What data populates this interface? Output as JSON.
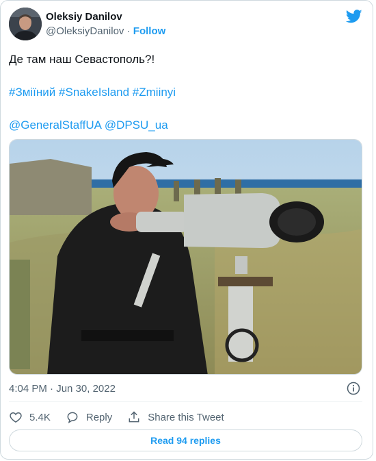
{
  "author": {
    "name": "Oleksiy Danilov",
    "handle": "@OleksiyDanilov",
    "separator": "·",
    "follow_label": "Follow",
    "avatar_icon": "avatar-photo"
  },
  "tweet": {
    "text": "Де там наш Севастополь?!",
    "hashtags": [
      "#Зміїний",
      "#SnakeIsland",
      "#Zmiinyi"
    ],
    "mentions": [
      "@GeneralStaffUA",
      "@DPSU_ua"
    ],
    "photo_icon": "photo-man-with-binoculars"
  },
  "meta": {
    "timestamp": "4:04 PM · Jun 30, 2022",
    "info_icon": "info-icon"
  },
  "actions": {
    "like_count": "5.4K",
    "reply_label": "Reply",
    "share_label": "Share this Tweet"
  },
  "footer": {
    "read_replies_label": "Read 94 replies"
  },
  "colors": {
    "accent": "#1d9bf0",
    "secondary_text": "#536471",
    "border": "#cfd9de"
  }
}
